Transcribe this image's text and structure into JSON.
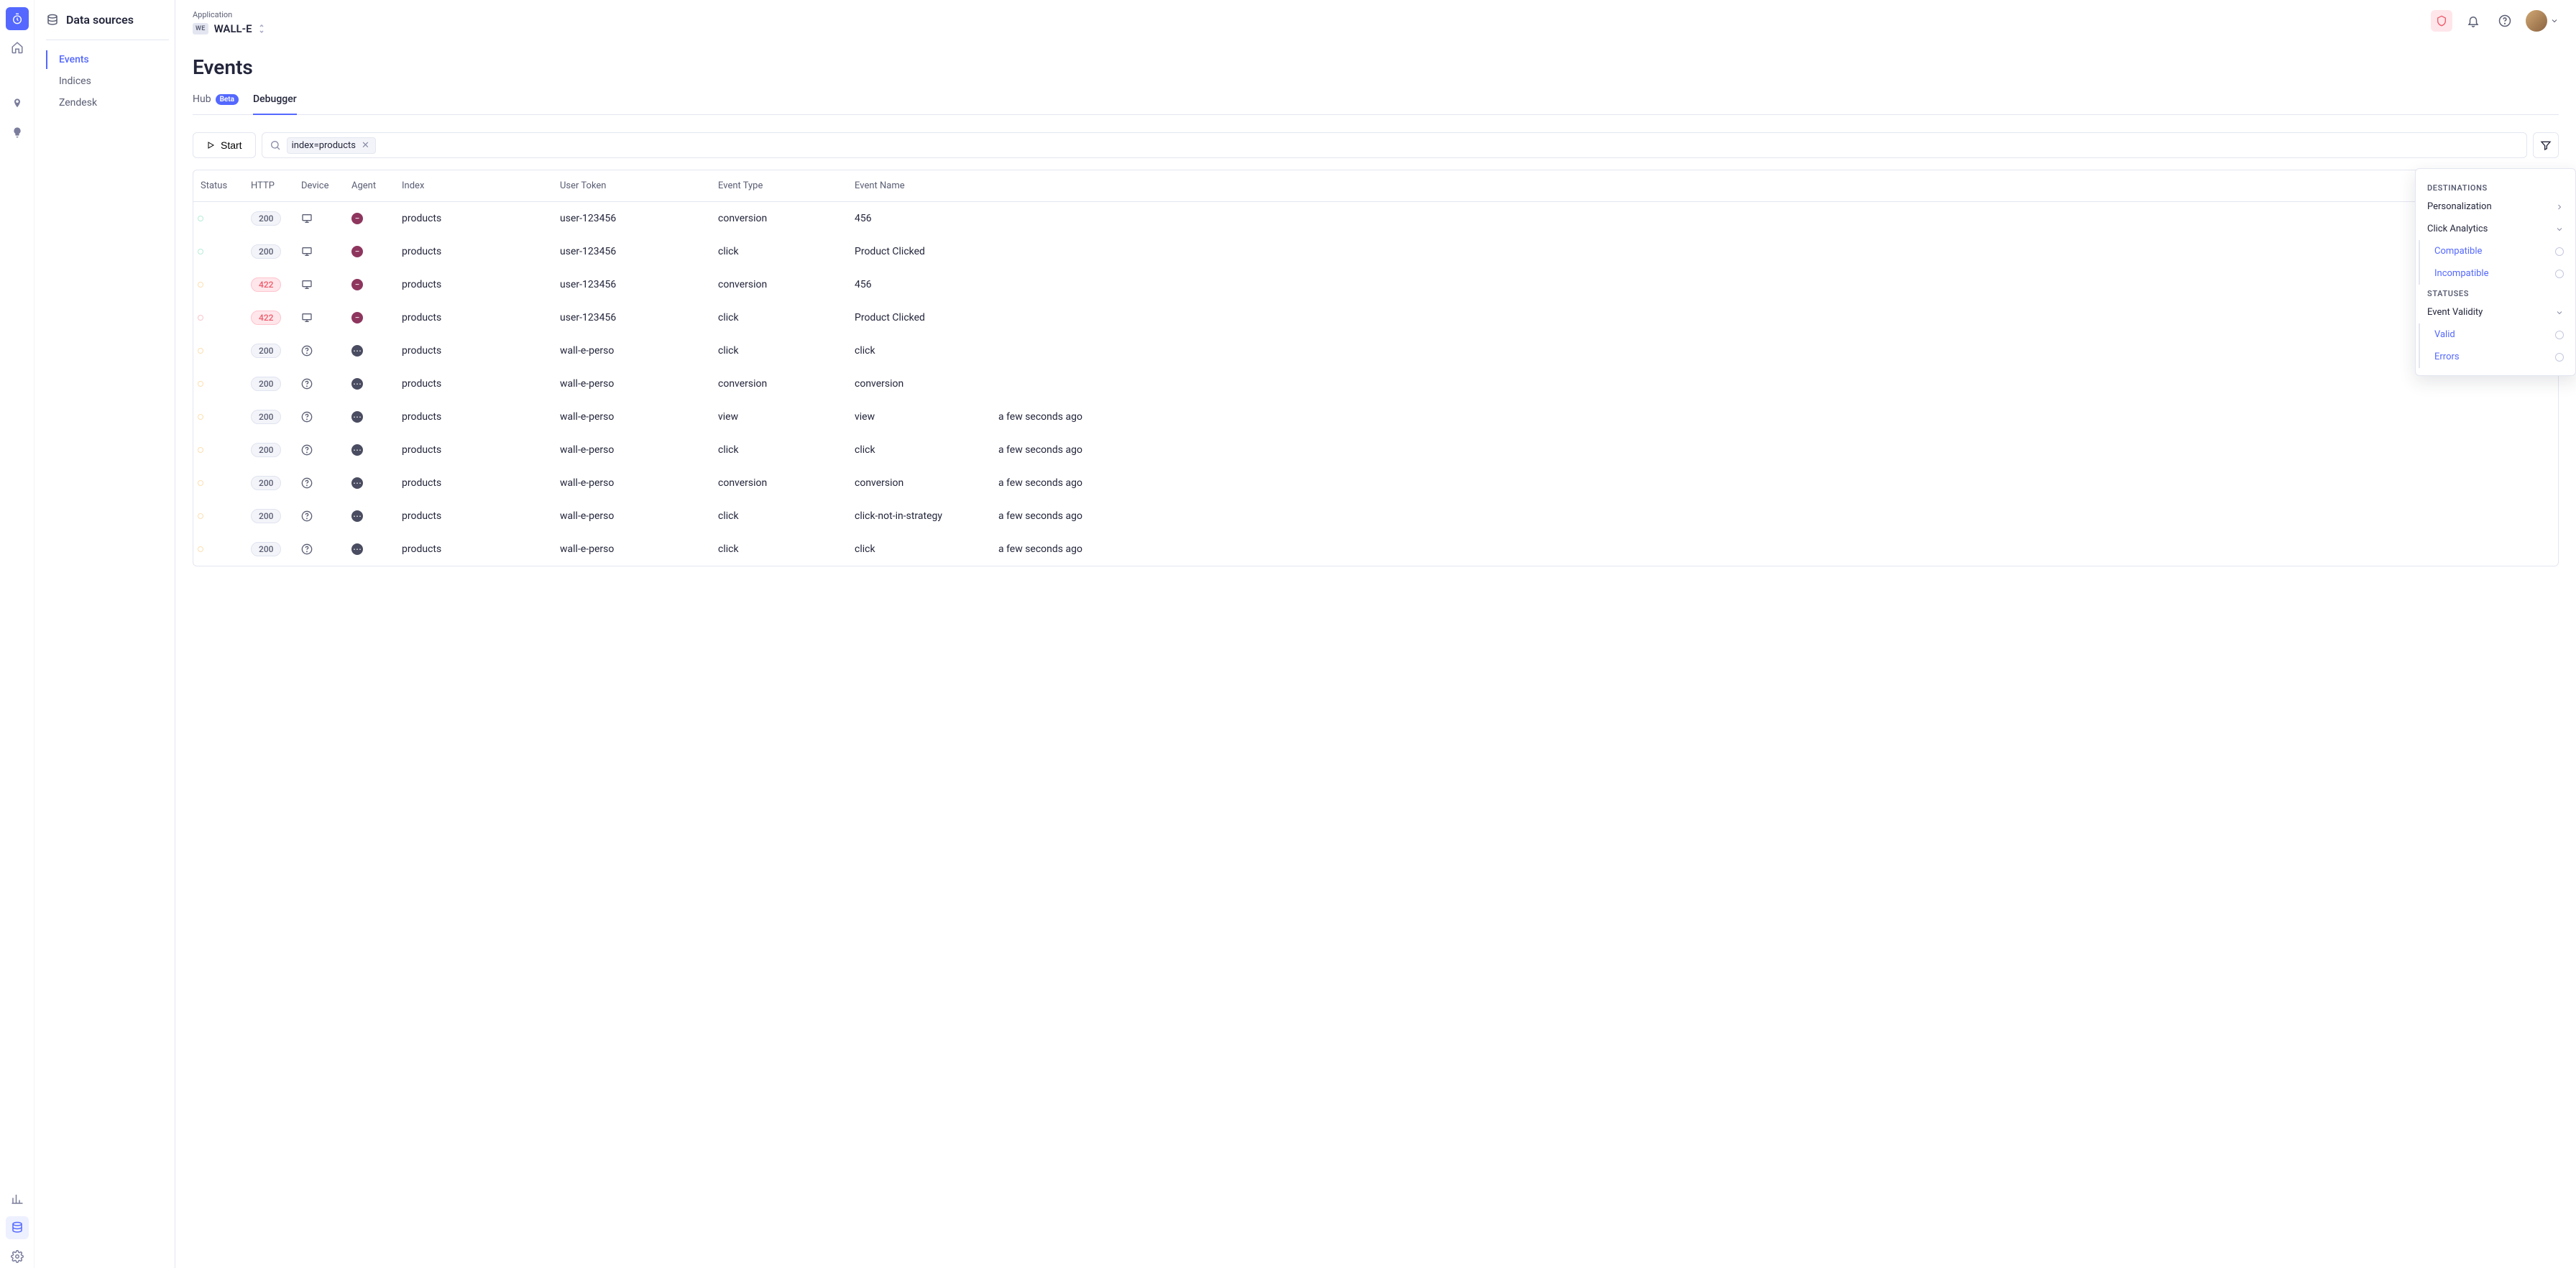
{
  "rail": {
    "icons": [
      "stopwatch",
      "home",
      "pin",
      "bulb",
      "bar-chart",
      "database",
      "gear"
    ]
  },
  "sidebar": {
    "title": "Data sources",
    "links": [
      {
        "label": "Events",
        "active": true
      },
      {
        "label": "Indices",
        "active": false
      },
      {
        "label": "Zendesk",
        "active": false
      }
    ]
  },
  "topbar": {
    "app_label": "Application",
    "app_badge": "WE",
    "app_name": "WALL-E"
  },
  "page": {
    "title": "Events"
  },
  "tabs": [
    {
      "label": "Hub",
      "badge": "Beta",
      "active": false
    },
    {
      "label": "Debugger",
      "badge": null,
      "active": true
    }
  ],
  "toolbar": {
    "start_label": "Start",
    "filter_chip": "index=products",
    "search_placeholder": ""
  },
  "columns": [
    "Status",
    "HTTP",
    "Device",
    "Agent",
    "Index",
    "User Token",
    "Event Type",
    "Event Name"
  ],
  "rows": [
    {
      "status": "green",
      "http": "200",
      "httpClass": "ok",
      "device": "desktop",
      "agent": "maroon",
      "agentGlyph": "minus",
      "index": "products",
      "userToken": "user-123456",
      "eventType": "conversion",
      "eventName": "456",
      "time": ""
    },
    {
      "status": "green",
      "http": "200",
      "httpClass": "ok",
      "device": "desktop",
      "agent": "maroon",
      "agentGlyph": "minus",
      "index": "products",
      "userToken": "user-123456",
      "eventType": "click",
      "eventName": "Product Clicked",
      "time": ""
    },
    {
      "status": "orange",
      "http": "422",
      "httpClass": "err",
      "device": "desktop",
      "agent": "maroon",
      "agentGlyph": "minus",
      "index": "products",
      "userToken": "user-123456",
      "eventType": "conversion",
      "eventName": "456",
      "time": ""
    },
    {
      "status": "red",
      "http": "422",
      "httpClass": "err",
      "device": "desktop",
      "agent": "maroon",
      "agentGlyph": "minus",
      "index": "products",
      "userToken": "user-123456",
      "eventType": "click",
      "eventName": "Product Clicked",
      "time": ""
    },
    {
      "status": "orange",
      "http": "200",
      "httpClass": "ok",
      "device": "question",
      "agent": "dark",
      "agentGlyph": "dots",
      "index": "products",
      "userToken": "wall-e-perso",
      "eventType": "click",
      "eventName": "click",
      "time": ""
    },
    {
      "status": "orange",
      "http": "200",
      "httpClass": "ok",
      "device": "question",
      "agent": "dark",
      "agentGlyph": "dots",
      "index": "products",
      "userToken": "wall-e-perso",
      "eventType": "conversion",
      "eventName": "conversion",
      "time": ""
    },
    {
      "status": "orange",
      "http": "200",
      "httpClass": "ok",
      "device": "question",
      "agent": "dark",
      "agentGlyph": "dots",
      "index": "products",
      "userToken": "wall-e-perso",
      "eventType": "view",
      "eventName": "view",
      "time": "a few seconds ago"
    },
    {
      "status": "orange",
      "http": "200",
      "httpClass": "ok",
      "device": "question",
      "agent": "dark",
      "agentGlyph": "dots",
      "index": "products",
      "userToken": "wall-e-perso",
      "eventType": "click",
      "eventName": "click",
      "time": "a few seconds ago"
    },
    {
      "status": "orange",
      "http": "200",
      "httpClass": "ok",
      "device": "question",
      "agent": "dark",
      "agentGlyph": "dots",
      "index": "products",
      "userToken": "wall-e-perso",
      "eventType": "conversion",
      "eventName": "conversion",
      "time": "a few seconds ago"
    },
    {
      "status": "orange",
      "http": "200",
      "httpClass": "ok",
      "device": "question",
      "agent": "dark",
      "agentGlyph": "dots",
      "index": "products",
      "userToken": "wall-e-perso",
      "eventType": "click",
      "eventName": "click-not-in-strategy",
      "time": "a few seconds ago"
    },
    {
      "status": "orange",
      "http": "200",
      "httpClass": "ok",
      "device": "question",
      "agent": "dark",
      "agentGlyph": "dots",
      "index": "products",
      "userToken": "wall-e-perso",
      "eventType": "click",
      "eventName": "click",
      "time": "a few seconds ago"
    }
  ],
  "popover": {
    "section1": "DESTINATIONS",
    "personalization": "Personalization",
    "click_analytics": "Click Analytics",
    "compatible": "Compatible",
    "incompatible": "Incompatible",
    "section2": "STATUSES",
    "event_validity": "Event Validity",
    "valid": "Valid",
    "errors": "Errors"
  }
}
